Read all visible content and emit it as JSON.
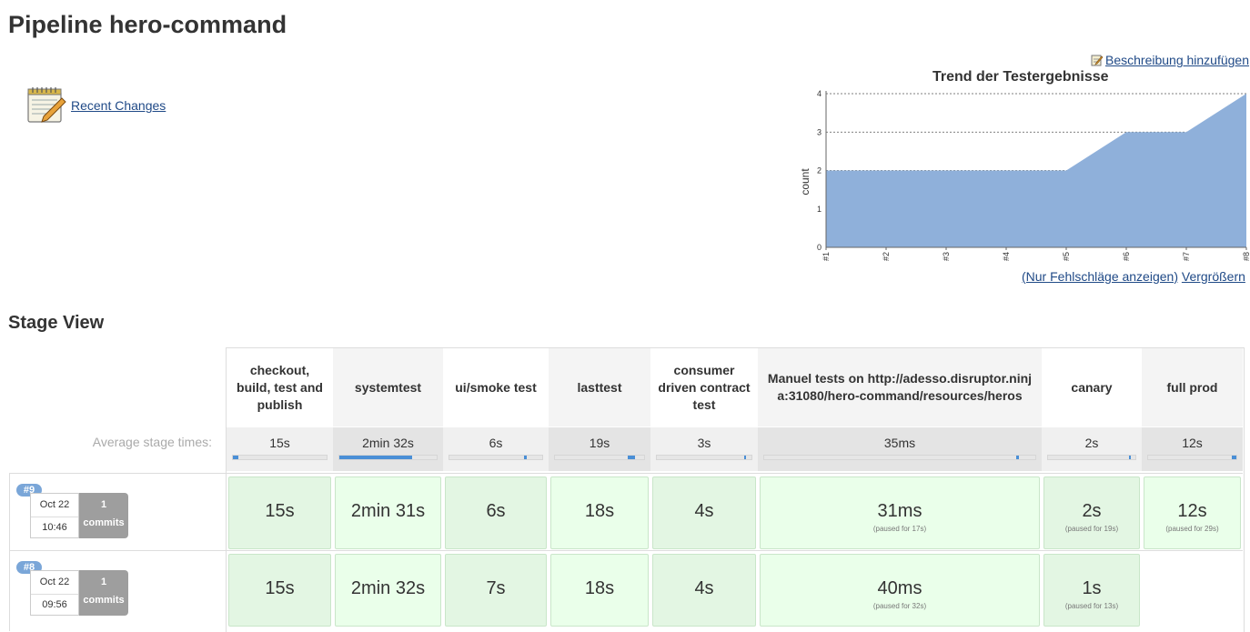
{
  "page": {
    "title": "Pipeline hero-command"
  },
  "sidebar": {
    "recent_changes": "Recent Changes"
  },
  "actions": {
    "add_description": "Beschreibung hinzufügen",
    "only_failures": "(Nur Fehlschläge anzeigen)",
    "enlarge": "Vergrößern"
  },
  "chart_data": {
    "type": "area",
    "title": "Trend der Testergebnisse",
    "ylabel": "count",
    "xlabel": "",
    "categories": [
      "#1",
      "#2",
      "#3",
      "#4",
      "#5",
      "#6",
      "#7",
      "#8"
    ],
    "values": [
      2,
      2,
      2,
      2,
      2,
      3,
      3,
      4
    ],
    "ylim": [
      0,
      4
    ],
    "yticks": [
      "0",
      "1",
      "2",
      "3",
      "4"
    ],
    "grid": true,
    "color": "#8fb0da"
  },
  "stage_view": {
    "title": "Stage View",
    "avg_label": "Average stage times:",
    "stages": [
      {
        "name": "checkout, build, test and publish",
        "avg": "15s",
        "bar_start": 0.0,
        "bar_len": 0.06
      },
      {
        "name": "systemtest",
        "avg": "2min 32s",
        "bar_start": 0.0,
        "bar_len": 0.75
      },
      {
        "name": "ui/smoke test",
        "avg": "6s",
        "bar_start": 0.8,
        "bar_len": 0.03
      },
      {
        "name": "lasttest",
        "avg": "19s",
        "bar_start": 0.82,
        "bar_len": 0.08
      },
      {
        "name": "consumer driven contract test",
        "avg": "3s",
        "bar_start": 0.92,
        "bar_len": 0.02
      },
      {
        "name": "Manuel tests on http://adesso.disruptor.ninja:31080/hero-command/resources/heros",
        "avg": "35ms",
        "bar_start": 0.93,
        "bar_len": 0.005
      },
      {
        "name": "canary",
        "avg": "2s",
        "bar_start": 0.93,
        "bar_len": 0.02
      },
      {
        "name": "full prod",
        "avg": "12s",
        "bar_start": 0.95,
        "bar_len": 0.05
      }
    ],
    "builds": [
      {
        "number": "#9",
        "date": "Oct 22",
        "time": "10:46",
        "commits_count": "1",
        "commits_label": "commits",
        "cells": [
          {
            "dur": "15s",
            "paused": ""
          },
          {
            "dur": "2min 31s",
            "paused": ""
          },
          {
            "dur": "6s",
            "paused": ""
          },
          {
            "dur": "18s",
            "paused": ""
          },
          {
            "dur": "4s",
            "paused": ""
          },
          {
            "dur": "31ms",
            "paused": "(paused for 17s)"
          },
          {
            "dur": "2s",
            "paused": "(paused for 19s)"
          },
          {
            "dur": "12s",
            "paused": "(paused for 29s)"
          }
        ]
      },
      {
        "number": "#8",
        "date": "Oct 22",
        "time": "09:56",
        "commits_count": "1",
        "commits_label": "commits",
        "cells": [
          {
            "dur": "15s",
            "paused": ""
          },
          {
            "dur": "2min 32s",
            "paused": ""
          },
          {
            "dur": "7s",
            "paused": ""
          },
          {
            "dur": "18s",
            "paused": ""
          },
          {
            "dur": "4s",
            "paused": ""
          },
          {
            "dur": "40ms",
            "paused": "(paused for 32s)"
          },
          {
            "dur": "1s",
            "paused": "(paused for 13s)"
          },
          null
        ]
      }
    ]
  }
}
